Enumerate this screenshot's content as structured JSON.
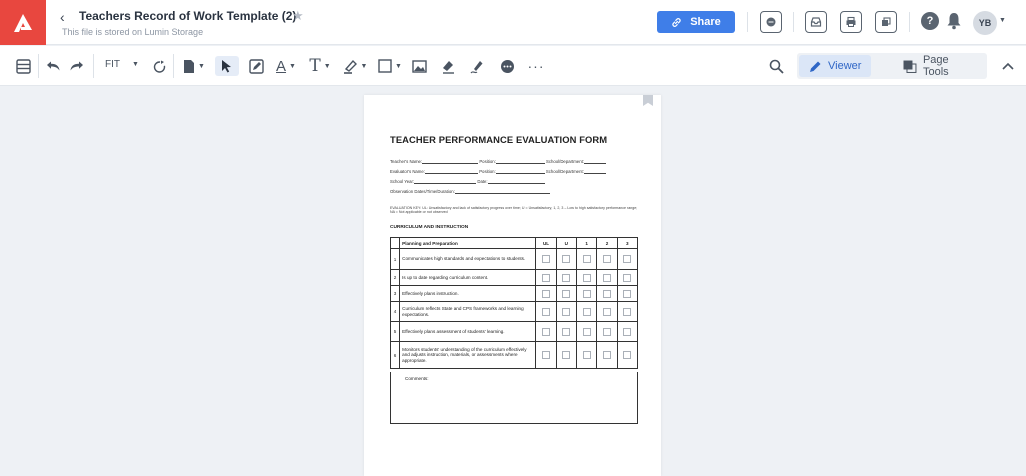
{
  "header": {
    "file_title": "Teachers Record of Work Template (2)",
    "storage_note": "This file is stored on Lumin Storage",
    "share_label": "Share",
    "avatar_initials": "YB"
  },
  "toolbar": {
    "zoom_label": "FIT",
    "modes": [
      {
        "label": "Viewer",
        "icon": "pen-icon",
        "active": true
      },
      {
        "label": "Page Tools",
        "icon": "pages-icon",
        "active": false
      }
    ]
  },
  "document": {
    "title": "TEACHER PERFORMANCE EVALUATION FORM",
    "fields": {
      "teacher_name": "Teacher's Name:",
      "position1": "Position:",
      "school_department1": "School/Department:",
      "evaluator_name": "Evaluator's Name:",
      "position2": "Position:",
      "school_department2": "School/Department:",
      "school_year": "School Year:",
      "date": "Date:",
      "observation": "Observation Dates/Time/Duration:"
    },
    "evaluation_key": "EVALUATION KEY: UL: Unsatisfactory and lack of satisfactory progress over time; U = Unsatisfactory; 1, 2, 3 – Low to high satisfactory performance range; NA = Not applicable or not observed",
    "section_title": "CURRICULUM AND INSTRUCTION",
    "table": {
      "header": "Planning and Preparation",
      "rating_columns": [
        "UL",
        "U",
        "1",
        "2",
        "3"
      ],
      "rows": [
        {
          "num": "1",
          "text": "Communicates high standards and expectations to students."
        },
        {
          "num": "2",
          "text": "Is up to date regarding curriculum content."
        },
        {
          "num": "3",
          "text": "Effectively plans instruction."
        },
        {
          "num": "4",
          "text": "Curriculum reflects State and CPS frameworks and learning expectations."
        },
        {
          "num": "5",
          "text": "Effectively plans assessment of students' learning."
        },
        {
          "num": "6",
          "text": "Monitors students' understanding of the curriculum effectively and adjusts instruction, materials, or assessments where appropriate."
        }
      ],
      "comments_label": "Comments:"
    }
  },
  "colors": {
    "brand": "#e8473f",
    "share": "#3f7ee8",
    "active_mode": "#2f66c6"
  }
}
